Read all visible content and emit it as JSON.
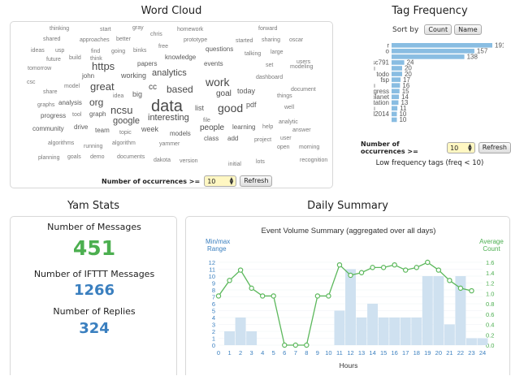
{
  "colors": {
    "wc_text": "#4a4a4a",
    "tag_bar": "#89bde2",
    "tag_bar_alt": "#c8c8c8",
    "green": "#4caf50",
    "blue": "#3a7fbf",
    "hour_bar": "#cfe1f0",
    "line": "#5cb85c"
  },
  "word_cloud": {
    "title": "Word Cloud",
    "words": [
      {
        "t": "thinking",
        "s": 7
      },
      {
        "t": "start",
        "s": 7
      },
      {
        "t": "gray",
        "s": 7
      },
      {
        "t": "homework",
        "s": 7
      },
      {
        "t": "forward",
        "s": 7
      },
      {
        "t": "chris",
        "s": 7
      },
      {
        "t": "shared",
        "s": 7
      },
      {
        "t": "approaches",
        "s": 7
      },
      {
        "t": "better",
        "s": 7
      },
      {
        "t": "prototype",
        "s": 7
      },
      {
        "t": "started",
        "s": 7
      },
      {
        "t": "sharing",
        "s": 7
      },
      {
        "t": "oscar",
        "s": 7
      },
      {
        "t": "free",
        "s": 7
      },
      {
        "t": "questions",
        "s": 8
      },
      {
        "t": "ideas",
        "s": 7
      },
      {
        "t": "usp",
        "s": 7
      },
      {
        "t": "find",
        "s": 7
      },
      {
        "t": "going",
        "s": 7
      },
      {
        "t": "binks",
        "s": 7
      },
      {
        "t": "talking",
        "s": 7
      },
      {
        "t": "large",
        "s": 7
      },
      {
        "t": "future",
        "s": 7
      },
      {
        "t": "build",
        "s": 7
      },
      {
        "t": "think",
        "s": 7
      },
      {
        "t": "knowledge",
        "s": 8
      },
      {
        "t": "users",
        "s": 7
      },
      {
        "t": "https",
        "s": 13
      },
      {
        "t": "papers",
        "s": 8
      },
      {
        "t": "events",
        "s": 8
      },
      {
        "t": "set",
        "s": 7
      },
      {
        "t": "modeling",
        "s": 7
      },
      {
        "t": "tomorrow",
        "s": 7
      },
      {
        "t": "analytics",
        "s": 11
      },
      {
        "t": "john",
        "s": 8
      },
      {
        "t": "working",
        "s": 9
      },
      {
        "t": "dashboard",
        "s": 7
      },
      {
        "t": "csc",
        "s": 7
      },
      {
        "t": "great",
        "s": 13
      },
      {
        "t": "work",
        "s": 14
      },
      {
        "t": "model",
        "s": 7
      },
      {
        "t": "cc",
        "s": 10
      },
      {
        "t": "based",
        "s": 12
      },
      {
        "t": "today",
        "s": 9
      },
      {
        "t": "document",
        "s": 7
      },
      {
        "t": "share",
        "s": 7
      },
      {
        "t": "idea",
        "s": 7
      },
      {
        "t": "big",
        "s": 9
      },
      {
        "t": "goal",
        "s": 10
      },
      {
        "t": "things",
        "s": 7
      },
      {
        "t": "org",
        "s": 12
      },
      {
        "t": "data",
        "s": 20
      },
      {
        "t": "analysis",
        "s": 8
      },
      {
        "t": "graphs",
        "s": 7
      },
      {
        "t": "list",
        "s": 9
      },
      {
        "t": "pdf",
        "s": 9
      },
      {
        "t": "well",
        "s": 7
      },
      {
        "t": "ncsu",
        "s": 13
      },
      {
        "t": "good",
        "s": 14
      },
      {
        "t": "progress",
        "s": 8
      },
      {
        "t": "tool",
        "s": 7
      },
      {
        "t": "graph",
        "s": 8
      },
      {
        "t": "file",
        "s": 7
      },
      {
        "t": "analytic",
        "s": 7
      },
      {
        "t": "interesting",
        "s": 11
      },
      {
        "t": "google",
        "s": 11
      },
      {
        "t": "community",
        "s": 8
      },
      {
        "t": "drive",
        "s": 8
      },
      {
        "t": "learning",
        "s": 8
      },
      {
        "t": "help",
        "s": 7
      },
      {
        "t": "team",
        "s": 8
      },
      {
        "t": "topic",
        "s": 7
      },
      {
        "t": "week",
        "s": 9
      },
      {
        "t": "people",
        "s": 10
      },
      {
        "t": "answer",
        "s": 7
      },
      {
        "t": "models",
        "s": 8
      },
      {
        "t": "user",
        "s": 7
      },
      {
        "t": "algorithms",
        "s": 7
      },
      {
        "t": "algorithm",
        "s": 7
      },
      {
        "t": "class",
        "s": 8
      },
      {
        "t": "add",
        "s": 8
      },
      {
        "t": "project",
        "s": 7
      },
      {
        "t": "running",
        "s": 7
      },
      {
        "t": "yammer",
        "s": 7
      },
      {
        "t": "open",
        "s": 7
      },
      {
        "t": "morning",
        "s": 7
      },
      {
        "t": "planning",
        "s": 7
      },
      {
        "t": "goals",
        "s": 7
      },
      {
        "t": "demo",
        "s": 7
      },
      {
        "t": "documents",
        "s": 7
      },
      {
        "t": "dakota",
        "s": 7
      },
      {
        "t": "version",
        "s": 7
      },
      {
        "t": "recognition",
        "s": 7
      },
      {
        "t": "initial",
        "s": 7
      },
      {
        "t": "lots",
        "s": 7
      }
    ],
    "occurrences_label": "Number of occurrences >=",
    "occurrences_value": "10",
    "refresh_label": "Refresh"
  },
  "tag_frequency": {
    "title": "Tag Frequency",
    "sort_label": "Sort by",
    "sort_count": "Count",
    "sort_name": "Name",
    "tags": [
      {
        "name": "r",
        "count": 191,
        "alt": false
      },
      {
        "name": "o",
        "count": 157,
        "alt": false
      },
      {
        "name": "",
        "count": 138,
        "alt": false
      },
      {
        "name": "csc791",
        "count": 24,
        "alt": false
      },
      {
        "name": "",
        "count": 20,
        "alt": true
      },
      {
        "name": "todo",
        "count": 20,
        "alt": false
      },
      {
        "name": "fsp",
        "count": 17,
        "alt": false
      },
      {
        "name": "",
        "count": 16,
        "alt": true
      },
      {
        "name": "progress",
        "count": 15,
        "alt": false
      },
      {
        "name": "saferplanet",
        "count": 14,
        "alt": false
      },
      {
        "name": "instrumentation",
        "count": 13,
        "alt": false
      },
      {
        "name": "",
        "count": 11,
        "alt": true
      },
      {
        "name": "kdd2014",
        "count": 10,
        "alt": false
      },
      {
        "name": "",
        "count": 10,
        "alt": false
      }
    ],
    "occurrences_label": "Number of occurrences >=",
    "occurrences_value": "10",
    "refresh_label": "Refresh",
    "low_freq_label": "Low frequency tags (freq < 10)"
  },
  "yam_stats": {
    "title": "Yam Stats",
    "messages_label": "Number of Messages",
    "messages_value": "451",
    "ifttt_label": "Number of IFTTT Messages",
    "ifttt_value": "1266",
    "replies_label": "Number of Replies",
    "replies_value": "324"
  },
  "daily_summary": {
    "title": "Daily Summary",
    "chart_title": "Event Volume Summary (aggregated over all days)",
    "left_legend": [
      "Min/max",
      "Range"
    ],
    "right_legend": [
      "Average",
      "Count"
    ],
    "xlabel": "Hours"
  },
  "chart_data": {
    "type": "bar",
    "title": "Event Volume Summary (aggregated over all days)",
    "xlabel": "Hours",
    "left_axis_ticks": [
      0,
      1,
      2,
      3,
      4,
      5,
      6,
      7,
      8,
      9,
      10,
      11,
      12
    ],
    "right_axis_ticks": [
      "0.0",
      "0.2",
      "0.4",
      "0.6",
      "0.8",
      "1.0",
      "1.2",
      "1.4",
      "1.6"
    ],
    "x_ticks": [
      0,
      1,
      2,
      3,
      4,
      5,
      6,
      7,
      8,
      9,
      10,
      11,
      12,
      13,
      14,
      15,
      16,
      17,
      18,
      19,
      20,
      21,
      22,
      23,
      24
    ],
    "range_bars": [
      {
        "h": 1,
        "min": 0,
        "max": 2
      },
      {
        "h": 2,
        "min": 0,
        "max": 4
      },
      {
        "h": 3,
        "min": 0,
        "max": 2
      },
      {
        "h": 11,
        "min": 0,
        "max": 5
      },
      {
        "h": 12,
        "min": 0,
        "max": 11
      },
      {
        "h": 13,
        "min": 0,
        "max": 4
      },
      {
        "h": 14,
        "min": 0,
        "max": 6
      },
      {
        "h": 15,
        "min": 0,
        "max": 4
      },
      {
        "h": 16,
        "min": 0,
        "max": 4
      },
      {
        "h": 17,
        "min": 0,
        "max": 4
      },
      {
        "h": 18,
        "min": 0,
        "max": 4
      },
      {
        "h": 19,
        "min": 0,
        "max": 10
      },
      {
        "h": 20,
        "min": 0,
        "max": 10
      },
      {
        "h": 21,
        "min": 0,
        "max": 3
      },
      {
        "h": 22,
        "min": 0,
        "max": 10
      },
      {
        "h": 23,
        "min": 0,
        "max": 1
      },
      {
        "h": 24,
        "min": 0,
        "max": 1
      }
    ],
    "series": [
      {
        "name": "Average Count",
        "x": [
          0,
          1,
          2,
          3,
          4,
          5,
          6,
          7,
          8,
          9,
          10,
          11,
          12,
          13,
          14,
          15,
          16,
          17,
          18,
          19,
          20,
          21,
          22,
          23
        ],
        "values": [
          0.95,
          1.25,
          1.45,
          1.1,
          0.95,
          0.95,
          0.0,
          0.0,
          0.0,
          0.95,
          0.95,
          1.55,
          1.35,
          1.4,
          1.5,
          1.5,
          1.55,
          1.45,
          1.5,
          1.6,
          1.45,
          1.25,
          1.1,
          1.05
        ]
      }
    ],
    "ylim_left": [
      0,
      12
    ],
    "ylim_right": [
      0,
      1.6
    ],
    "xlim": [
      0,
      24
    ]
  }
}
